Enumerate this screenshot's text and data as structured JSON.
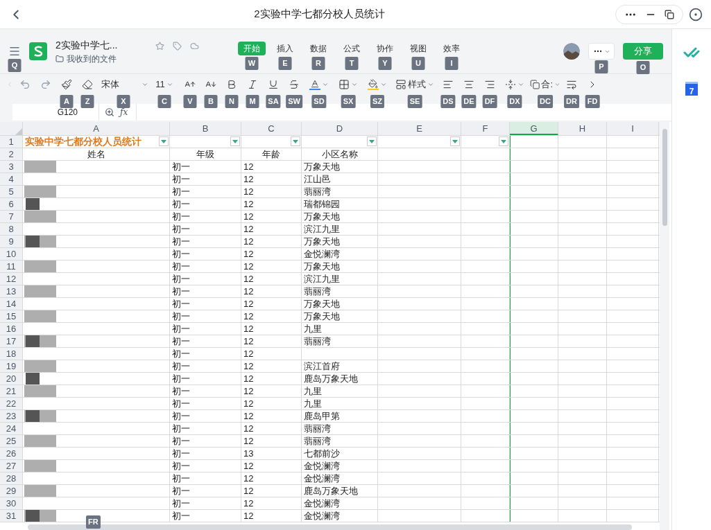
{
  "window": {
    "title": "2实验中学七都分校人员统计"
  },
  "document": {
    "name": "2实验中学七...",
    "folder": "我收到的文件",
    "menu_key": "Q"
  },
  "tabs": [
    {
      "label": "开始",
      "selected": true,
      "key": "W"
    },
    {
      "label": "插入",
      "selected": false,
      "key": "E"
    },
    {
      "label": "数据",
      "selected": false,
      "key": "R"
    },
    {
      "label": "公式",
      "selected": false,
      "key": "T"
    },
    {
      "label": "协作",
      "selected": false,
      "key": "Y"
    },
    {
      "label": "视图",
      "selected": false,
      "key": "U"
    },
    {
      "label": "效率",
      "selected": false,
      "key": "I"
    }
  ],
  "more_key": "P",
  "share": {
    "label": "分享",
    "key": "O"
  },
  "toolbar": [
    {
      "kind": "painter",
      "key": "A"
    },
    {
      "kind": "eraser",
      "key": "Z"
    },
    {
      "kind": "font",
      "label": "宋体",
      "key": "X"
    },
    {
      "kind": "size",
      "label": "11",
      "key": "C"
    },
    {
      "kind": "grow",
      "key": "V"
    },
    {
      "kind": "shrink",
      "key": "B"
    },
    {
      "kind": "bold",
      "key": "N"
    },
    {
      "kind": "italic",
      "key": "M"
    },
    {
      "kind": "underline",
      "key": "SA"
    },
    {
      "kind": "strike",
      "key": "SW"
    },
    {
      "kind": "color",
      "key": "SD"
    },
    {
      "kind": "border",
      "key": "SX"
    },
    {
      "kind": "fill",
      "key": "SZ"
    },
    {
      "kind": "style",
      "label": "样式",
      "key": "SE"
    },
    {
      "kind": "left",
      "key": "DS"
    },
    {
      "kind": "center",
      "key": "DE"
    },
    {
      "kind": "right",
      "key": "DF"
    },
    {
      "kind": "valign",
      "key": "DX"
    },
    {
      "kind": "merge",
      "label": "合:",
      "key": "DC"
    },
    {
      "kind": "wrap",
      "key": "DR"
    },
    {
      "kind": "next",
      "key": "FD"
    }
  ],
  "formula_bar": {
    "cell": "G120",
    "function_label": "ƒx"
  },
  "columns": [
    {
      "letter": "A",
      "selected": false
    },
    {
      "letter": "B",
      "selected": false
    },
    {
      "letter": "C",
      "selected": false
    },
    {
      "letter": "D",
      "selected": false
    },
    {
      "letter": "E",
      "selected": false
    },
    {
      "letter": "F",
      "selected": false
    },
    {
      "letter": "G",
      "selected": true
    },
    {
      "letter": "H",
      "selected": false
    },
    {
      "letter": "I",
      "selected": false
    }
  ],
  "sheet_title": "实验中学七都分校人员统计",
  "title_row_number": "1",
  "headers": [
    "姓名",
    "年级",
    "年龄",
    "小区名称"
  ],
  "header_row_number": "2",
  "rows": [
    {
      "number": "3",
      "grade": "初一",
      "age": "12",
      "community": "万象天地"
    },
    {
      "number": "4",
      "grade": "初一",
      "age": "12",
      "community": "江山邑"
    },
    {
      "number": "5",
      "grade": "初一",
      "age": "12",
      "community": "翡丽湾"
    },
    {
      "number": "6",
      "grade": "初一",
      "age": "12",
      "community": "瑞都锦园"
    },
    {
      "number": "7",
      "grade": "初一",
      "age": "12",
      "community": "万象天地"
    },
    {
      "number": "8",
      "grade": "初一",
      "age": "12",
      "community": "滨江九里"
    },
    {
      "number": "9",
      "grade": "初一",
      "age": "12",
      "community": "万象天地"
    },
    {
      "number": "10",
      "grade": "初一",
      "age": "12",
      "community": "金悦澜湾"
    },
    {
      "number": "11",
      "grade": "初一",
      "age": "12",
      "community": "万象天地"
    },
    {
      "number": "12",
      "grade": "初一",
      "age": "12",
      "community": "滨江九里"
    },
    {
      "number": "13",
      "grade": "初一",
      "age": "12",
      "community": "翡丽湾"
    },
    {
      "number": "14",
      "grade": "初一",
      "age": "12",
      "community": "万象天地"
    },
    {
      "number": "15",
      "grade": "初一",
      "age": "12",
      "community": "万象天地"
    },
    {
      "number": "16",
      "grade": "初一",
      "age": "12",
      "community": "九里"
    },
    {
      "number": "17",
      "grade": "初一",
      "age": "12",
      "community": "翡丽湾"
    },
    {
      "number": "18",
      "grade": "初一",
      "age": "12"
    },
    {
      "number": "19",
      "grade": "初一",
      "age": "12",
      "community": "滨江首府"
    },
    {
      "number": "20",
      "grade": "初一",
      "age": "12",
      "community": "鹿岛万象天地"
    },
    {
      "number": "21",
      "grade": "初一",
      "age": "12",
      "community": "九里"
    },
    {
      "number": "22",
      "grade": "初一",
      "age": "12",
      "community": "九里"
    },
    {
      "number": "23",
      "grade": "初一",
      "age": "12",
      "community": "鹿岛甲第"
    },
    {
      "number": "24",
      "grade": "初一",
      "age": "12",
      "community": "翡丽湾"
    },
    {
      "number": "25",
      "grade": "初一",
      "age": "12",
      "community": "翡丽湾"
    },
    {
      "number": "26",
      "grade": "初一",
      "age": "13",
      "community": "七都前沙"
    },
    {
      "number": "27",
      "grade": "初一",
      "age": "12",
      "community": "金悦澜湾"
    },
    {
      "number": "28",
      "grade": "初一",
      "age": "12",
      "community": "金悦澜湾"
    },
    {
      "number": "29",
      "grade": "初一",
      "age": "12",
      "community": "鹿岛万象天地"
    },
    {
      "number": "30",
      "grade": "初一",
      "age": "12",
      "community": "金悦澜湾"
    },
    {
      "number": "31",
      "grade": "初一",
      "age": "12",
      "community": "金悦澜湾"
    }
  ],
  "sheet_key": "FR",
  "sidebar": {
    "calendar_day": "7"
  }
}
